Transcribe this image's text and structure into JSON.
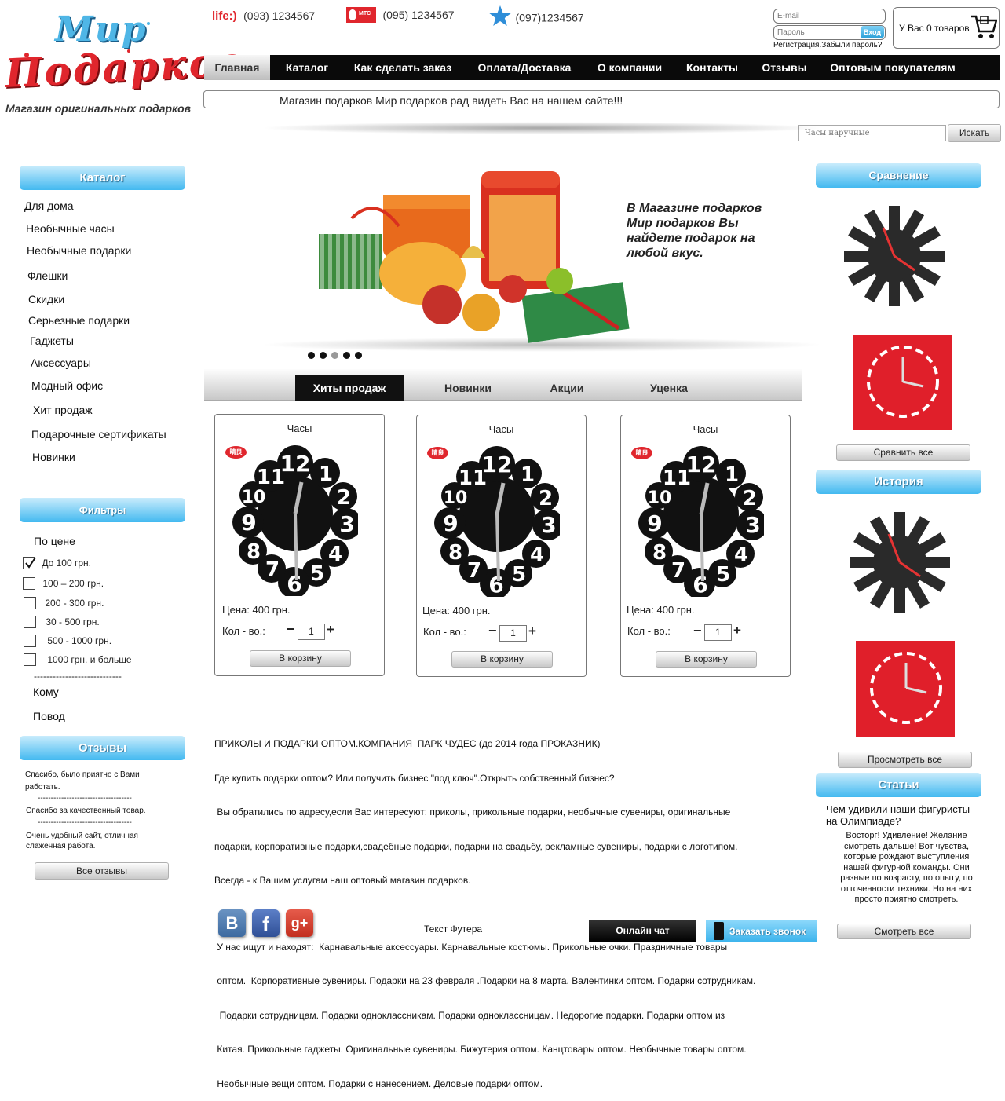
{
  "logo": {
    "line1": "Мир",
    "line2": "Подарков",
    "tagline": "Магазин оригинальных подарков"
  },
  "phones": [
    {
      "brand": "life:)",
      "number": "(093) 1234567"
    },
    {
      "brand": "МТС",
      "number": "(095) 1234567"
    },
    {
      "number": "(097)1234567"
    }
  ],
  "login": {
    "email_placeholder": "E-mail",
    "password_placeholder": "Пароль",
    "login_button": "Вход",
    "register": "Регистрация.",
    "forgot": "Забыли пароль?"
  },
  "cart": {
    "label": "У Вас 0 товаров"
  },
  "nav": [
    "Главная",
    "Каталог",
    "Как сделать заказ",
    "Оплата/Доставка",
    "О компании",
    "Контакты",
    "Отзывы",
    "Оптовым покупателям"
  ],
  "marquee": "Магазин подарков Мир подарков рад видеть Вас на нашем сайте!!!",
  "search": {
    "placeholder": "Часы наручные",
    "button": "Искать"
  },
  "banner": {
    "text": "В Магазине подарков Мир подарков Вы найдете подарок на любой вкус.",
    "dots": 5,
    "active_dot": 3
  },
  "catalog": {
    "title": "Каталог",
    "items": [
      "Для дома",
      "Необычные часы",
      "Необычные подарки",
      "Флешки",
      "Скидки",
      "Серьезные подарки",
      "Гаджеты",
      "Аксессуары",
      "Модный офис",
      "Хит продаж",
      "Подарочные сертификаты",
      "Новинки"
    ]
  },
  "filters": {
    "title": "Фильтры",
    "price_label": "По цене",
    "options": [
      {
        "label": "До 100 грн.",
        "checked": true
      },
      {
        "label": "100 – 200 грн.",
        "checked": false
      },
      {
        "label": "200 - 300 грн.",
        "checked": false
      },
      {
        "label": "30 - 500 грн.",
        "checked": false
      },
      {
        "label": "500 - 1000 грн.",
        "checked": false
      },
      {
        "label": "1000 грн. и больше",
        "checked": false
      }
    ],
    "divider": "----------------------------",
    "whom": "Кому",
    "occasion": "Повод"
  },
  "reviews": {
    "title": "Отзывы",
    "items": [
      "Спасибо, было приятно с Вами работать.",
      "Спасибо за качественный товар.",
      "Очень удобный сайт, отличная слаженная работа."
    ],
    "divider": "------------------------------------",
    "all_button": "Все отзывы"
  },
  "tabs": [
    "Хиты продаж",
    "Новинки",
    "Акции",
    "Уценка"
  ],
  "products": [
    {
      "title": "Часы",
      "price": "Цена: 400 грн.",
      "qty_label": "Кол - во.:",
      "qty": "1",
      "button": "В корзину",
      "badge": "晴良"
    },
    {
      "title": "Часы",
      "price": "Цена: 400 грн.",
      "qty_label": "Кол - во.:",
      "qty": "1",
      "button": "В корзину",
      "badge": "晴良"
    },
    {
      "title": "Часы",
      "price": "Цена: 400 грн.",
      "qty_label": "Кол - во.:",
      "qty": "1",
      "button": "В корзину",
      "badge": "晴良"
    }
  ],
  "article": {
    "p1": [
      "ПРИКОЛЫ И ПОДАРКИ ОПТОМ.КОМПАНИЯ  ПАРК ЧУДЕС (до 2014 года ПРОКАЗНИК)",
      "Где купить подарки оптом? Или получить бизнес \"под ключ\".Открыть собственный бизнес?",
      " Вы обратились по адресу,если Вас интересуют: приколы, прикольные подарки, необычные сувениры, оригинальные",
      "подарки, корпоративные подарки,свадебные подарки, подарки на свадьбу, рекламные сувениры, подарки с логотипом.",
      "Всегда - к Вашим услугам наш оптовый магазин подарков."
    ],
    "p2": [
      " У нас ищут и находят:  Карнавальные аксессуары. Карнавальные костюмы. Прикольные очки. Праздничные товары",
      " оптом.  Корпоративные сувениры. Подарки на 23 февраля .Подарки на 8 марта. Валентинки оптом. Подарки сотрудникам.",
      "  Подарки сотрудницам. Подарки одноклассникам. Подарки одноклассницам. Недорогие подарки. Подарки оптом из",
      " Китая. Прикольные гаджеты. Оригинальные сувениры. Бижутерия оптом. Канцтовары оптом. Необычные товары оптом.",
      " Необычные вещи оптом. Подарки с нанесением. Деловые подарки оптом."
    ]
  },
  "compare": {
    "title": "Сравнение",
    "button": "Сравнить все"
  },
  "history": {
    "title": "История",
    "button": "Просмотреть все"
  },
  "articles": {
    "title": "Статьи",
    "headline": "Чем удивили наши фигуристы на Олимпиаде?",
    "text": "Восторг! Удивление! Желание смотреть дальше! Вот чувства, которые рождают выступления нашей фигурной команды. Они разные по возрасту, по опыту, по отточенности техники. Но на них просто приятно смотреть.",
    "button": "Смотреть все"
  },
  "footer": {
    "text": "Текст Футера",
    "chat": "Онлайн чат",
    "callback": "Заказать звонок",
    "social": [
      "vk-icon",
      "facebook-icon",
      "google-plus-icon"
    ]
  },
  "colors": {
    "accent_blue": "#43b9f0",
    "nav_bg": "#0a0a0a",
    "red": "#e0262d"
  }
}
